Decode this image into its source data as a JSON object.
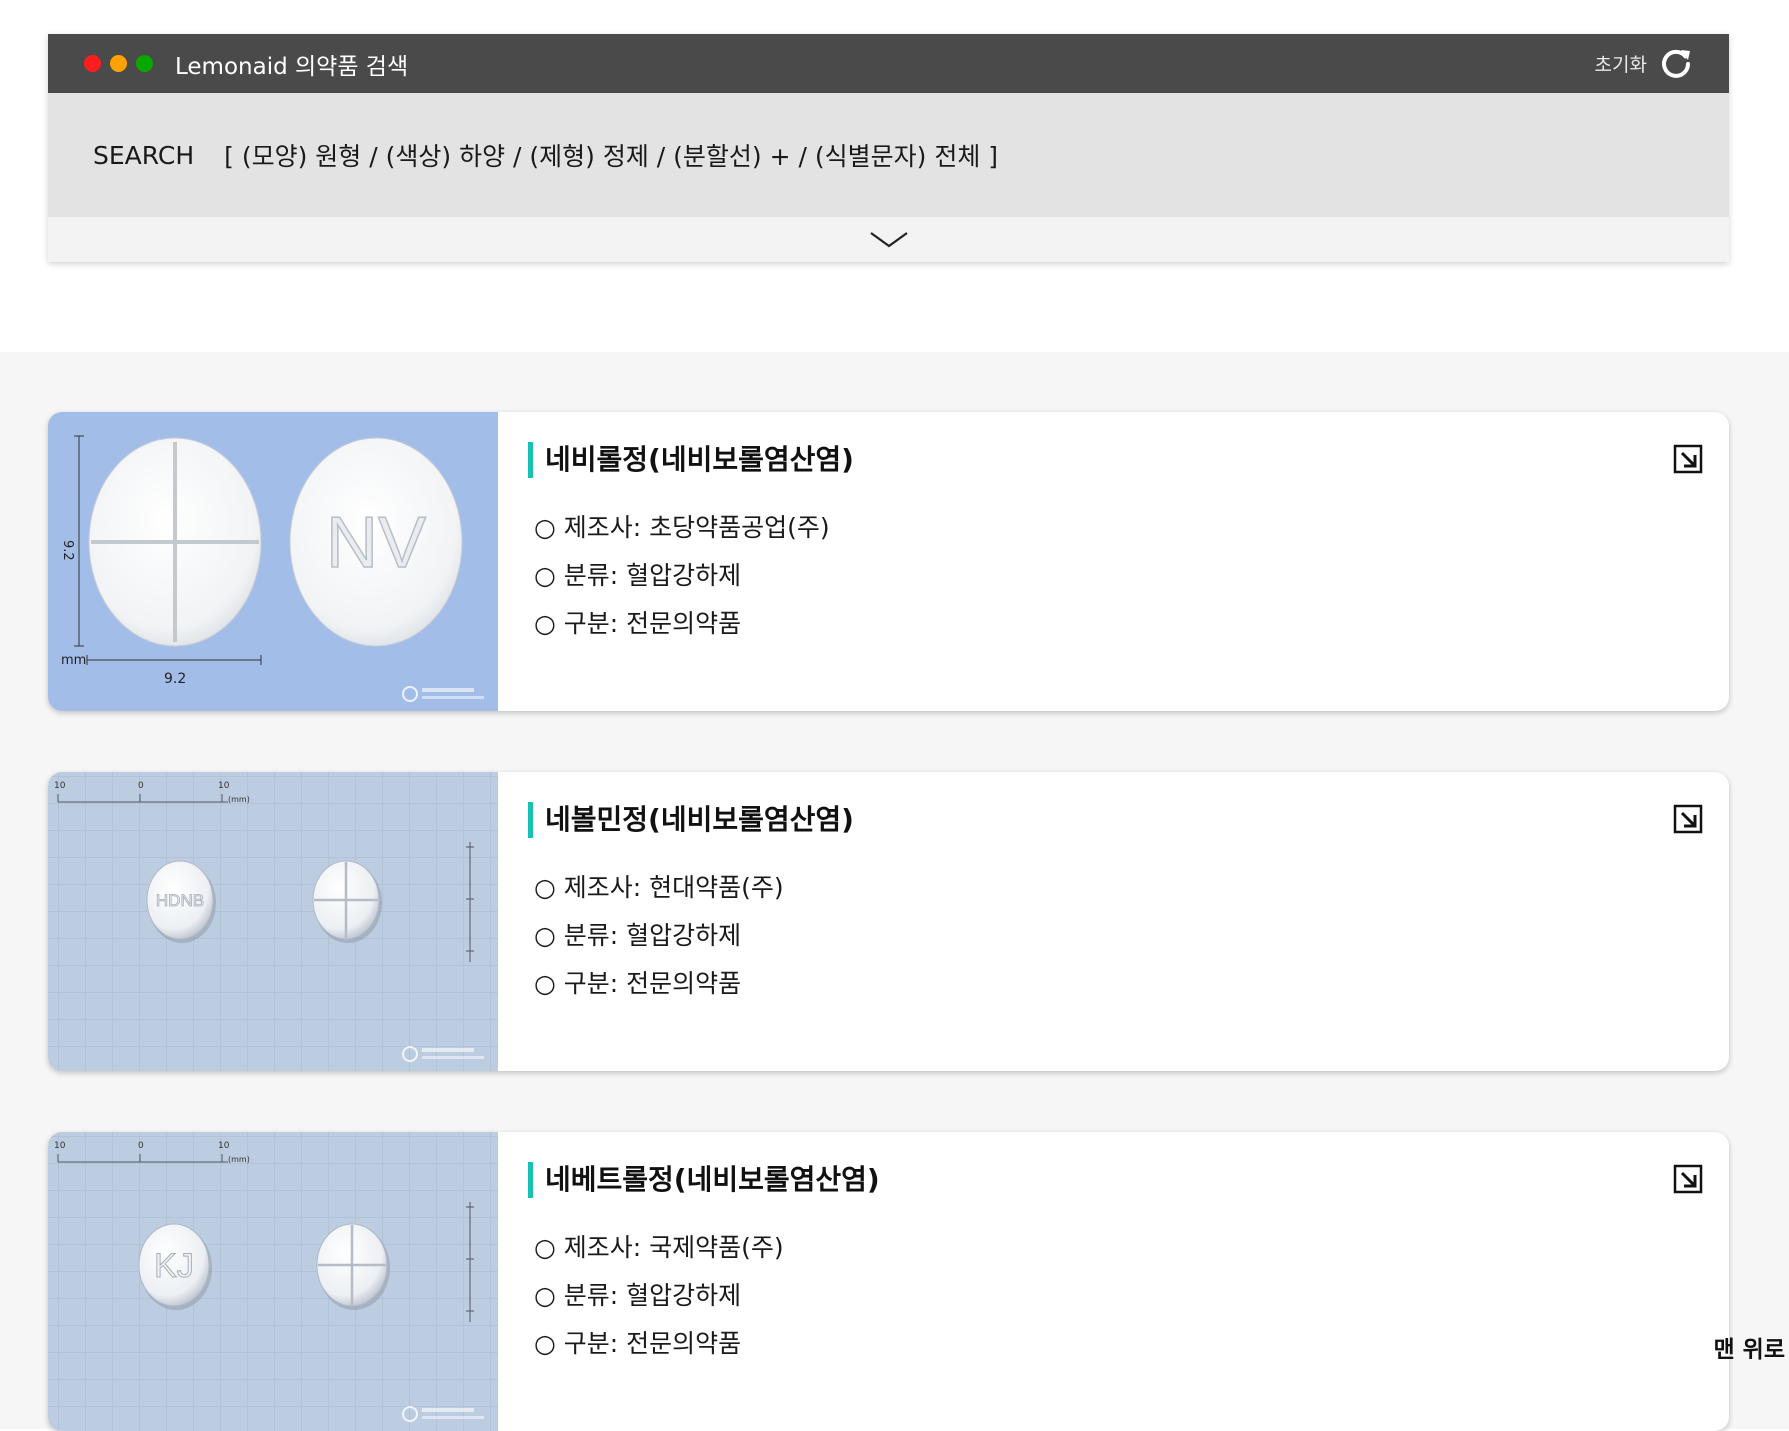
{
  "app": {
    "title": "Lemonaid 의약품 검색",
    "reset_label": "초기화"
  },
  "search": {
    "label": "SEARCH",
    "criteria": "[ (모양) 원형 / (색상) 하양 / (제형) 정제 / (분할선) + / (식별문자) 전체 ]"
  },
  "results": [
    {
      "name": "네비롤정(네비보롤염산염)",
      "manufacturer": "○ 제조사: 초당약품공업(주)",
      "category": "○ 분류: 혈압강하제",
      "type": "○ 구분: 전문의약품",
      "image": {
        "background": "#a3bde9",
        "imprint": "NV",
        "dim_v": "9.2",
        "dim_h": "9.2",
        "unit": "mm"
      }
    },
    {
      "name": "네볼민정(네비보롤염산염)",
      "manufacturer": "○ 제조사: 현대약품(주)",
      "category": "○ 분류: 혈압강하제",
      "type": "○ 구분: 전문의약품",
      "image": {
        "background": "#bccde2",
        "imprint": "HDNB",
        "ruler_left": "10",
        "ruler_zero": "0",
        "ruler_right": "10",
        "ruler_unit": "(mm)"
      }
    },
    {
      "name": "네베트롤정(네비보롤염산염)",
      "manufacturer": "○ 제조사: 국제약품(주)",
      "category": "○ 분류: 혈압강하제",
      "type": "○ 구분: 전문의약품",
      "image": {
        "background": "#bccde2",
        "imprint": "KJ",
        "ruler_left": "10",
        "ruler_zero": "0",
        "ruler_right": "10",
        "ruler_unit": "(mm)"
      }
    }
  ],
  "scroll_top_label": "맨 위로",
  "icons": {
    "reset": "refresh-icon",
    "expand": "chevron-down-icon",
    "open": "external-link-icon",
    "bullet": "circle-icon"
  },
  "colors": {
    "titlebar": "#4a4a4a",
    "accent": "#17c2b5",
    "dot_red": "#ff1d1d",
    "dot_orange": "#ffa200",
    "dot_green": "#08a800"
  }
}
